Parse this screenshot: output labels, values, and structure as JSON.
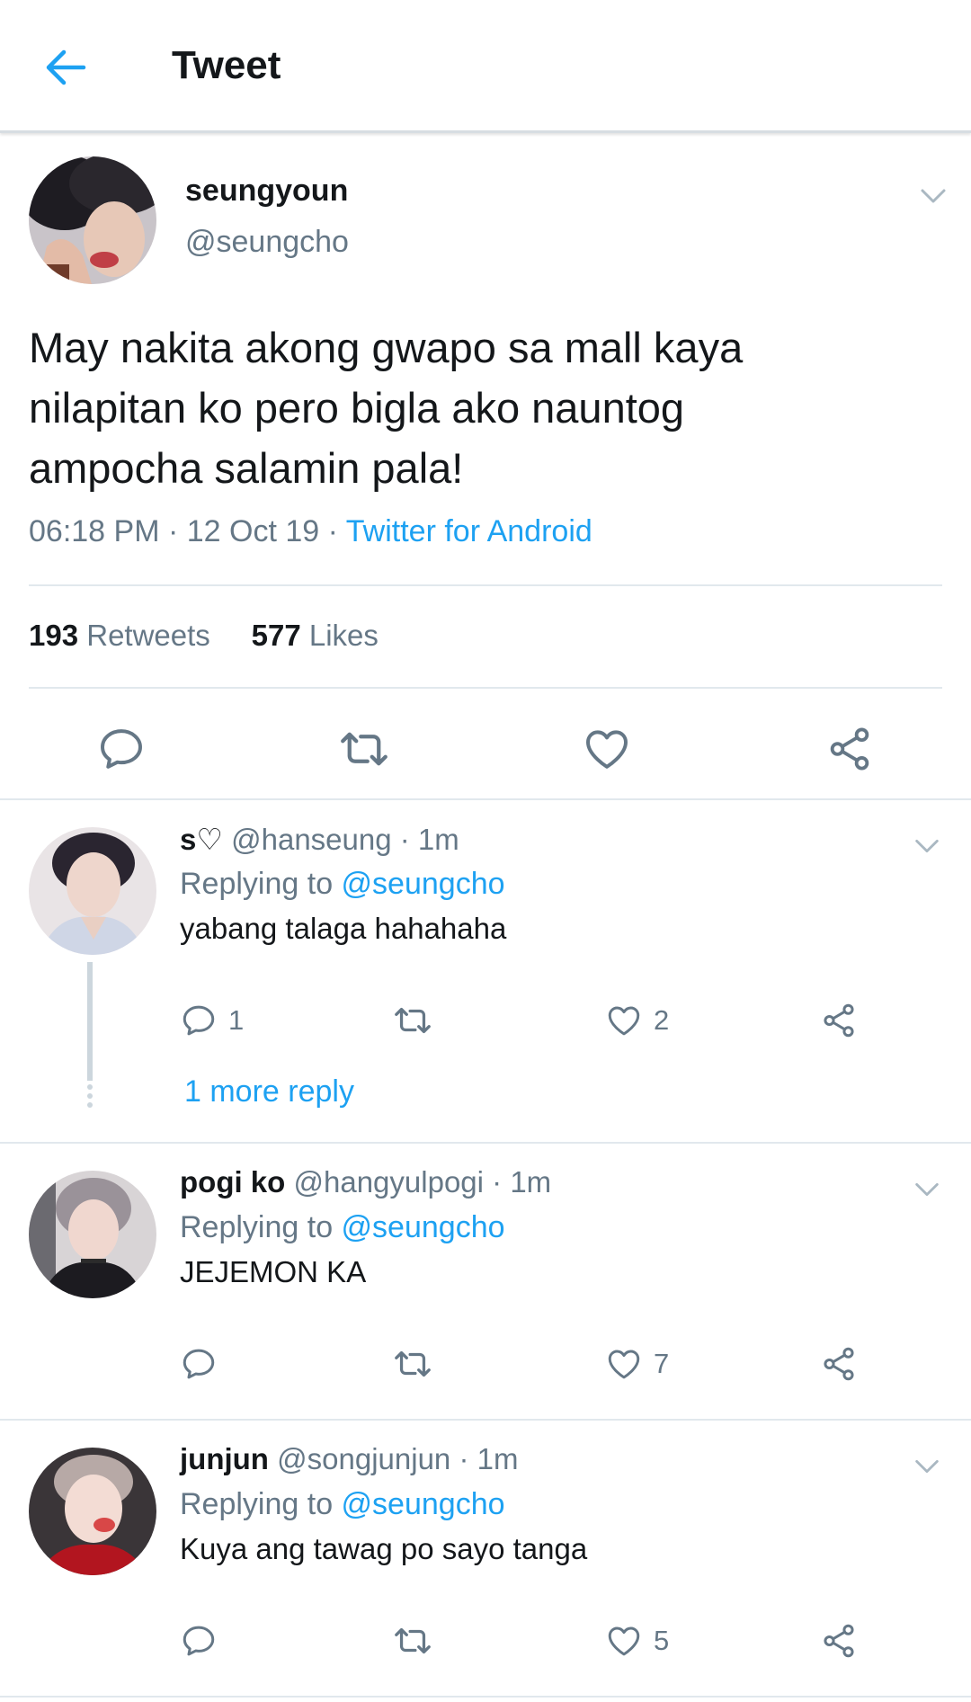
{
  "header": {
    "title": "Tweet"
  },
  "tweet": {
    "display_name": "seungyoun",
    "handle": "@seungcho",
    "text": "May nakita akong gwapo sa mall kaya\nnilapitan ko pero bigla ako nauntog\nampocha salamin pala!",
    "time": "06:18 PM · 12 Oct 19 · ",
    "source": "Twitter for Android",
    "retweets_count": "193",
    "retweets_label": "Retweets",
    "likes_count": "577",
    "likes_label": "Likes"
  },
  "replies": [
    {
      "display_name": "s♡",
      "handle_time": "@hanseung · 1m",
      "replying_label": "Replying to ",
      "replying_to": "@seungcho",
      "text": "yabang talaga hahahaha",
      "reply_count": "1",
      "like_count": "2",
      "more_replies": "1 more reply"
    },
    {
      "display_name": "pogi ko",
      "handle_time": "@hangyulpogi · 1m",
      "replying_label": "Replying to ",
      "replying_to": "@seungcho",
      "text": "JEJEMON KA",
      "like_count": "7"
    },
    {
      "display_name": "junjun",
      "handle_time": "@songjunjun · 1m",
      "replying_label": "Replying to ",
      "replying_to": "@seungcho",
      "text": "Kuya ang tawag po sayo tanga",
      "like_count": "5"
    }
  ],
  "colors": {
    "accent": "#1da1f2",
    "muted": "#657786",
    "text": "#14171a",
    "divider": "#e1e8ed"
  },
  "icons": [
    "back-arrow-icon",
    "chevron-down-icon",
    "reply-icon",
    "retweet-icon",
    "like-icon",
    "share-icon"
  ]
}
